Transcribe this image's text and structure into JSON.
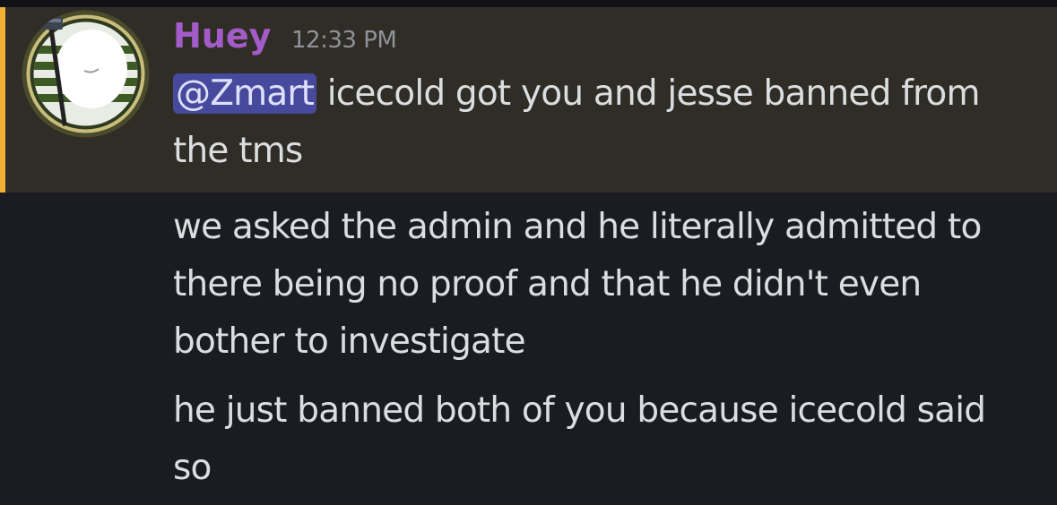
{
  "message": {
    "author": "Huey",
    "timestamp": "12:33 PM",
    "mention": "@Zmart",
    "first_text": " icecold got you and jesse banned from the tms"
  },
  "followups": [
    "we asked the admin and he literally admitted to there being no proof and that he didn't even bother to investigate",
    "he just banned both of you because icecold said so"
  ],
  "colors": {
    "background": "#1b1c21",
    "highlight": "#302d26",
    "mention_bar": "#f0b132",
    "username": "#a35cc7",
    "mention_bg": "#474a9c",
    "text": "#dbdee1"
  }
}
